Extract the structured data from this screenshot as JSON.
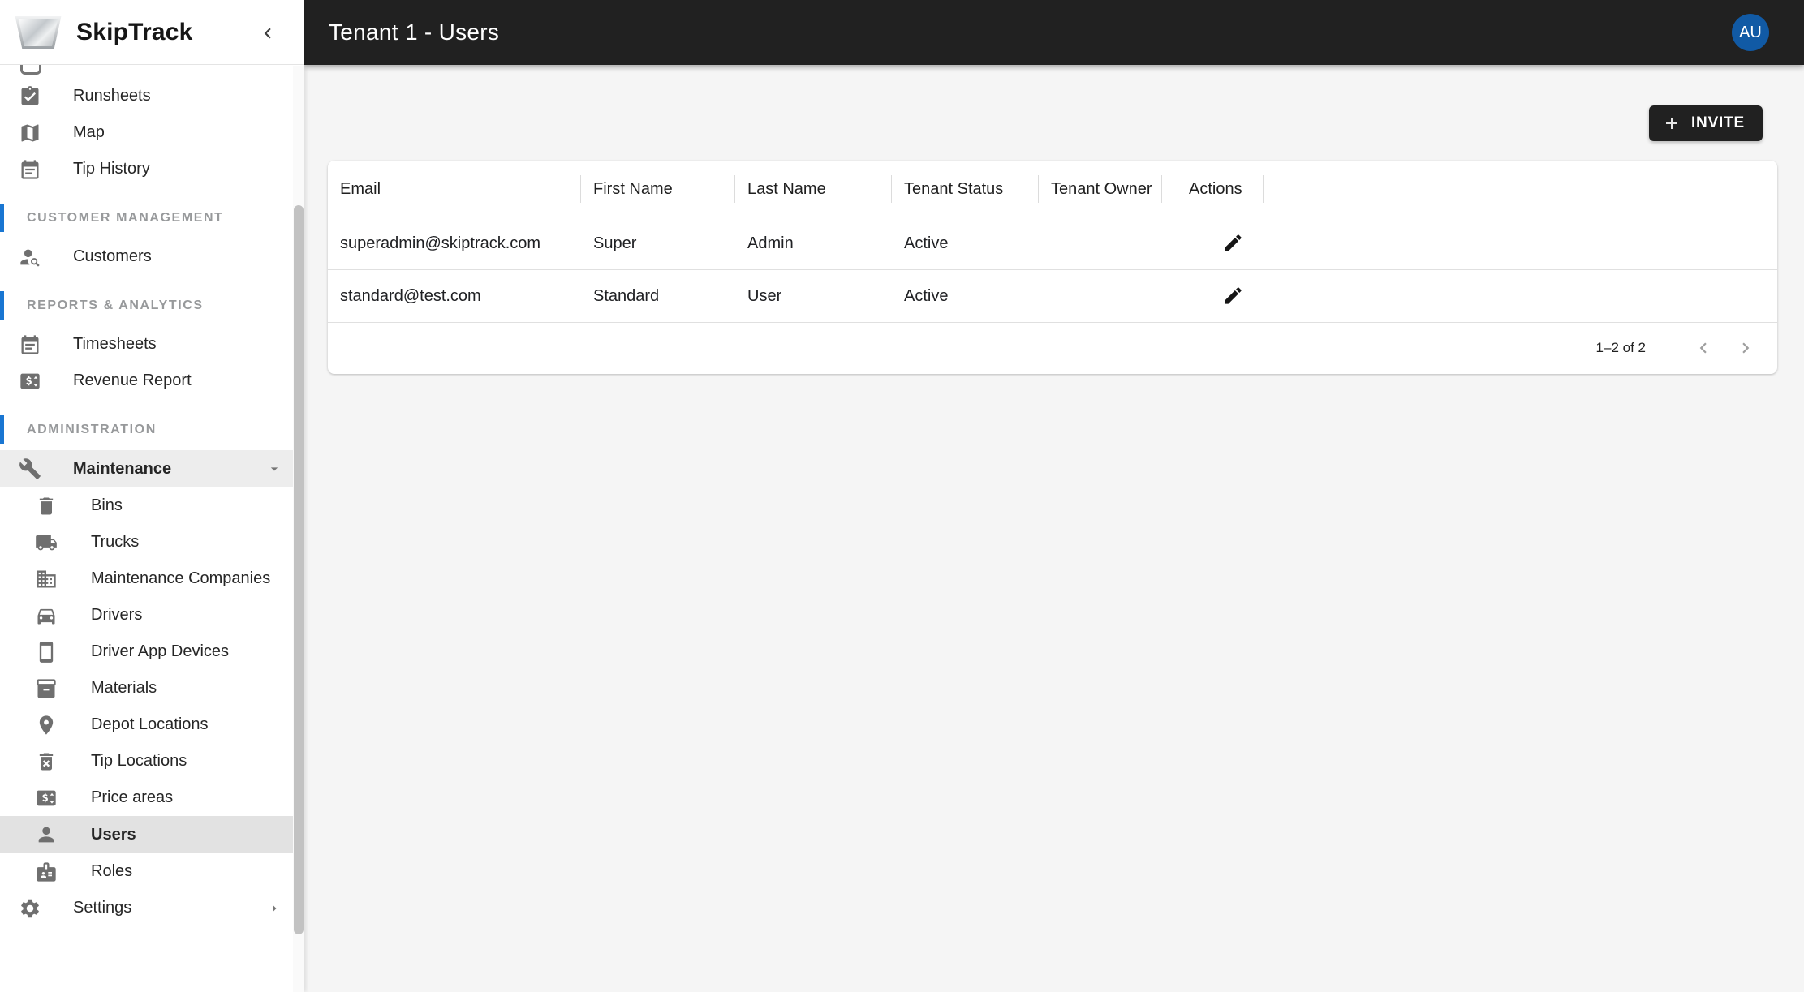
{
  "app": {
    "name": "SkipTrack"
  },
  "header": {
    "title": "Tenant 1 - Users",
    "avatar_initials": "AU"
  },
  "sidebar": {
    "sections": [
      "CUSTOMER MANAGEMENT",
      "REPORTS & ANALYTICS",
      "ADMINISTRATION"
    ],
    "items": [
      {
        "label": "Runsheets",
        "icon": "runsheets-icon"
      },
      {
        "label": "Map",
        "icon": "map-icon"
      },
      {
        "label": "Tip History",
        "icon": "calendar-icon"
      },
      {
        "label": "Customers",
        "icon": "person-search-icon"
      },
      {
        "label": "Timesheets",
        "icon": "calendar-icon"
      },
      {
        "label": "Revenue Report",
        "icon": "money-badge-icon"
      },
      {
        "label": "Maintenance",
        "icon": "wrench-icon",
        "expanded": true
      },
      {
        "label": "Bins",
        "icon": "trash-icon"
      },
      {
        "label": "Trucks",
        "icon": "truck-icon"
      },
      {
        "label": "Maintenance Companies",
        "icon": "building-icon"
      },
      {
        "label": "Drivers",
        "icon": "car-icon"
      },
      {
        "label": "Driver App Devices",
        "icon": "smartphone-icon"
      },
      {
        "label": "Materials",
        "icon": "box-icon"
      },
      {
        "label": "Depot Locations",
        "icon": "pin-icon"
      },
      {
        "label": "Tip Locations",
        "icon": "trash-x-icon"
      },
      {
        "label": "Price areas",
        "icon": "money-badge-icon"
      },
      {
        "label": "Users",
        "icon": "person-icon",
        "selected": true
      },
      {
        "label": "Roles",
        "icon": "badge-icon"
      },
      {
        "label": "Settings",
        "icon": "gear-icon",
        "collapsed": true
      }
    ]
  },
  "toolbar": {
    "invite_label": "INVITE"
  },
  "table": {
    "columns": [
      "Email",
      "First Name",
      "Last Name",
      "Tenant Status",
      "Tenant Owner",
      "Actions"
    ],
    "rows": [
      {
        "email": "superadmin@skiptrack.com",
        "first_name": "Super",
        "last_name": "Admin",
        "tenant_status": "Active",
        "tenant_owner": ""
      },
      {
        "email": "standard@test.com",
        "first_name": "Standard",
        "last_name": "User",
        "tenant_status": "Active",
        "tenant_owner": ""
      }
    ],
    "pagination": {
      "range_label": "1–2 of 2"
    }
  },
  "colors": {
    "topbar": "#212121",
    "accent_blue": "#1976d2",
    "avatar_blue": "#115aa5",
    "sidebar_icon_gray": "#6f6f6f",
    "divider": "#e0e0e0",
    "main_background": "#f5f5f5"
  }
}
